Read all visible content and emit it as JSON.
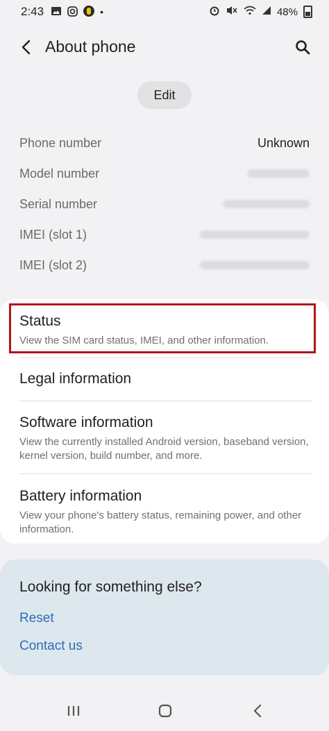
{
  "status_bar": {
    "time": "2:43",
    "battery": "48%",
    "left_icons": [
      "gallery-icon",
      "instagram-icon",
      "norton-icon",
      "dot-icon"
    ],
    "right_icons": [
      "alarm-icon",
      "mute-icon",
      "wifi-icon",
      "signal-icon",
      "battery-icon"
    ]
  },
  "header": {
    "title": "About phone"
  },
  "edit_label": "Edit",
  "info": [
    {
      "label": "Phone number",
      "value": "Unknown"
    },
    {
      "label": "Model number",
      "value": ""
    },
    {
      "label": "Serial number",
      "value": ""
    },
    {
      "label": "IMEI (slot 1)",
      "value": ""
    },
    {
      "label": "IMEI (slot 2)",
      "value": ""
    }
  ],
  "menu": [
    {
      "title": "Status",
      "subtitle": "View the SIM card status, IMEI, and other information."
    },
    {
      "title": "Legal information",
      "subtitle": ""
    },
    {
      "title": "Software information",
      "subtitle": "View the currently installed Android version, baseband version, kernel version, build number, and more."
    },
    {
      "title": "Battery information",
      "subtitle": "View your phone's battery status, remaining power, and other information."
    }
  ],
  "looking": {
    "title": "Looking for something else?",
    "links": [
      "Reset",
      "Contact us"
    ]
  },
  "colors": {
    "highlight": "#b3141b",
    "link": "#2a6eb5"
  }
}
